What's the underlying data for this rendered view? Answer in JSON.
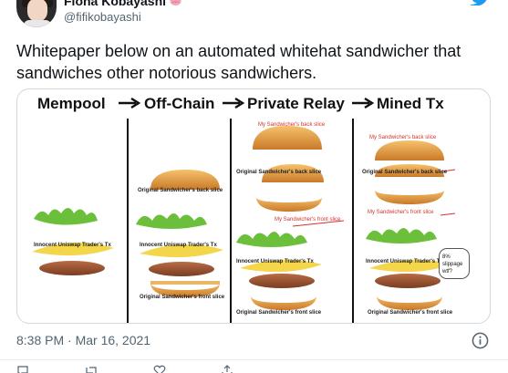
{
  "author": {
    "display_name": "Fiona Kobayashi",
    "handle": "@fifikobayashi",
    "emoji_icon": "brain-emoji-icon"
  },
  "tweet": {
    "text": "Whitepaper below on an automated whitehat sandwicher that sandwiches other notorious sandwichers."
  },
  "media": {
    "panels": [
      {
        "title": "Mempool"
      },
      {
        "title": "Off-Chain"
      },
      {
        "title": "Private Relay"
      },
      {
        "title": "Mined Tx"
      }
    ],
    "labels": {
      "innocent_tx": "Innocent Uniswap Trader's Tx",
      "orig_back": "Original Sandwicher's back slice",
      "orig_front": "Original Sandwicher's front slice",
      "my_back": "My Sandwicher's back slice",
      "my_front": "My Sandwicher's front slice",
      "bubble": "8% slippage wtf?"
    },
    "colors": {
      "red_label": "#d0342c",
      "bun": "#e8a24a",
      "lettuce": "#6bbf3a",
      "patty": "#8a4a2a",
      "cheese": "#f4d64a"
    }
  },
  "meta": {
    "timestamp": "8:38 PM · Mar 16, 2021"
  },
  "icons": [
    "twitter-bird-icon",
    "info-icon"
  ]
}
